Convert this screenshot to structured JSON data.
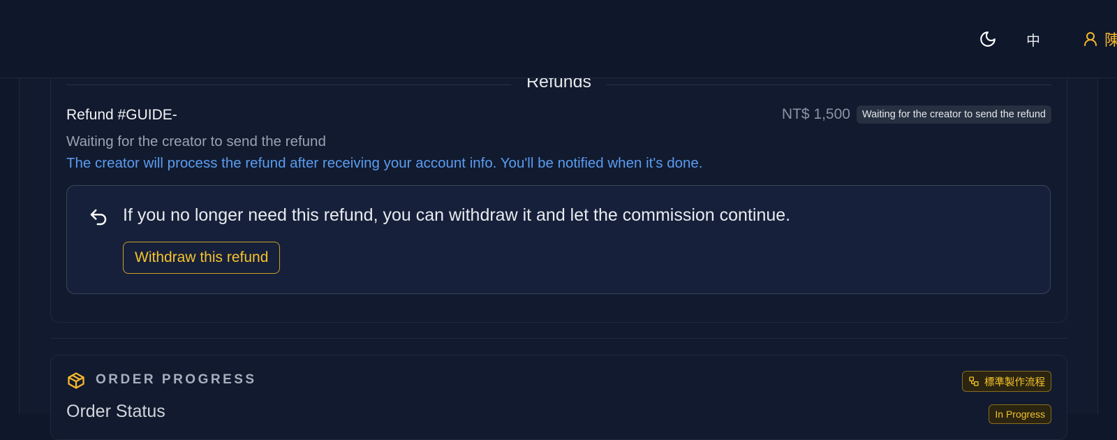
{
  "header": {
    "language_label": "中",
    "user_name": "陳",
    "colors": {
      "accent": "#f5b72d",
      "header_bg": "#0f172a"
    },
    "icons": {
      "theme": "moon-icon",
      "user": "user-icon"
    }
  },
  "refunds": {
    "section_title": "Refunds",
    "refund_id": "Refund #GUIDE-",
    "amount": "NT$ 1,500",
    "status_badge": "Waiting for the creator to send the refund",
    "status_text": "Waiting for the creator to send the refund",
    "info_text": "The creator will process the refund after receiving your account info. You'll be notified when it's done.",
    "withdraw": {
      "icon": "undo-icon",
      "message": "If you no longer need this refund, you can withdraw it and let the commission continue.",
      "button_label": "Withdraw this refund"
    },
    "colors": {
      "info": "#5b9cf0",
      "button": "#f5c32d"
    }
  },
  "order_progress": {
    "icon": "package-icon",
    "heading": "ORDER PROGRESS",
    "process_badge": "標準製作流程",
    "process_icon": "workflow-icon",
    "status_label": "Order Status",
    "status_badge": "In Progress"
  }
}
